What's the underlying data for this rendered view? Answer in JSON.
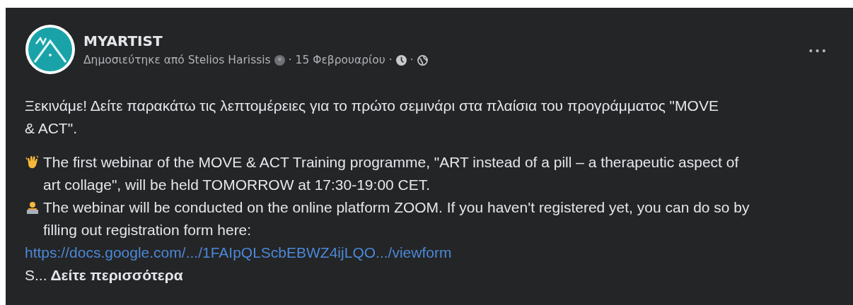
{
  "post": {
    "page_name": "MYARTIST",
    "posted_by": "Δημοσιεύτηκε από Stelios Harissis",
    "separator": "·",
    "date": "15 Φεβρουαρίου",
    "menu": "•••",
    "intro": "Ξεκινάμε! Δείτε παρακάτω τις λεπτομέρειες για το πρώτο σεμινάρι στα πλαίσια του προγράμματος \"MOVE & ACT\".",
    "lines": [
      {
        "kind": "wave",
        "text": "The first webinar of the MOVE & ACT Training programme, \"ART instead of a pill – a therapeutic aspect of art collage\", will be held TOMORROW at 17:30-19:00 CET."
      },
      {
        "kind": "person",
        "text": "The webinar will be conducted on the online platform ZOOM. If you haven't registered yet, you can do so by filling out registration form here:"
      },
      {
        "kind": "link",
        "text": "https://docs.google.com/.../1FAIpQLScbEBWZ4ijLQO.../viewform"
      },
      {
        "kind": "truncated",
        "text": "S...",
        "more": "Δείτε περισσότερα"
      }
    ]
  }
}
